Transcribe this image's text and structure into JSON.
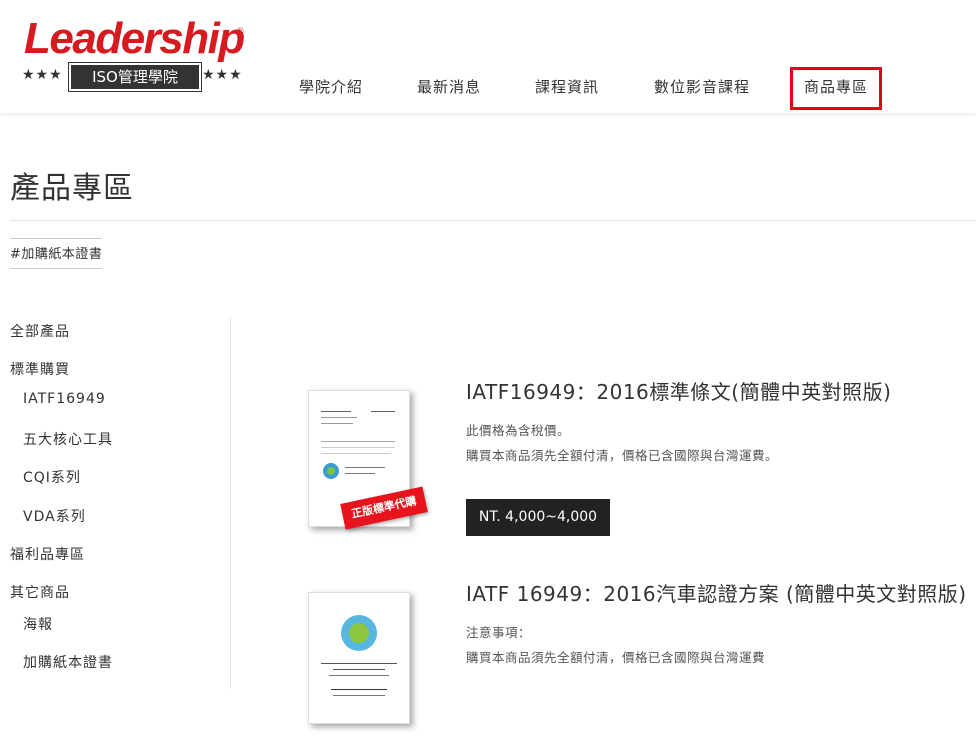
{
  "brand": {
    "logo_text": "Leadership",
    "registered_mark": "®",
    "stars_left": "★★★",
    "stars_right": "★★★",
    "badge_text": "ISO管理學院"
  },
  "nav": {
    "items": [
      {
        "label": "學院介紹"
      },
      {
        "label": "最新消息"
      },
      {
        "label": "課程資訊"
      },
      {
        "label": "數位影音課程"
      },
      {
        "label": "商品專區"
      }
    ],
    "active_index": 4,
    "active_color": "#e6001a"
  },
  "page": {
    "title": "產品專區",
    "tag": "#加購紙本證書"
  },
  "sidebar": {
    "items": [
      {
        "label": "全部產品",
        "level": 0
      },
      {
        "label": "標準購買",
        "level": 0
      },
      {
        "label": "IATF16949",
        "level": 1
      },
      {
        "label": "五大核心工具",
        "level": 1
      },
      {
        "label": "CQI系列",
        "level": 1
      },
      {
        "label": "VDA系列",
        "level": 1
      },
      {
        "label": "福利品專區",
        "level": 0
      },
      {
        "label": "其它商品",
        "level": 0
      },
      {
        "label": "海報",
        "level": 1
      },
      {
        "label": "加購紙本證書",
        "level": 1
      }
    ]
  },
  "products": [
    {
      "title": "IATF16949：2016標準條文(簡體中英對照版)",
      "lines": [
        "此價格為含稅價。",
        "購買本商品須先全額付清，價格已含國際與台灣運費。"
      ],
      "price": "NT. 4,000~4,000",
      "stamp": "正版標準代購",
      "doc_icon": "iatf-globe-icon"
    },
    {
      "title": "IATF 16949：2016汽車認證方案 (簡體中英文對照版)",
      "lines": [
        "注意事項：",
        "購買本商品須先全額付清，價格已含國際與台灣運費"
      ],
      "doc_icon": "iatf-logo-icon"
    }
  ],
  "colors": {
    "brand_red": "#d71920",
    "price_bg": "#222222"
  }
}
